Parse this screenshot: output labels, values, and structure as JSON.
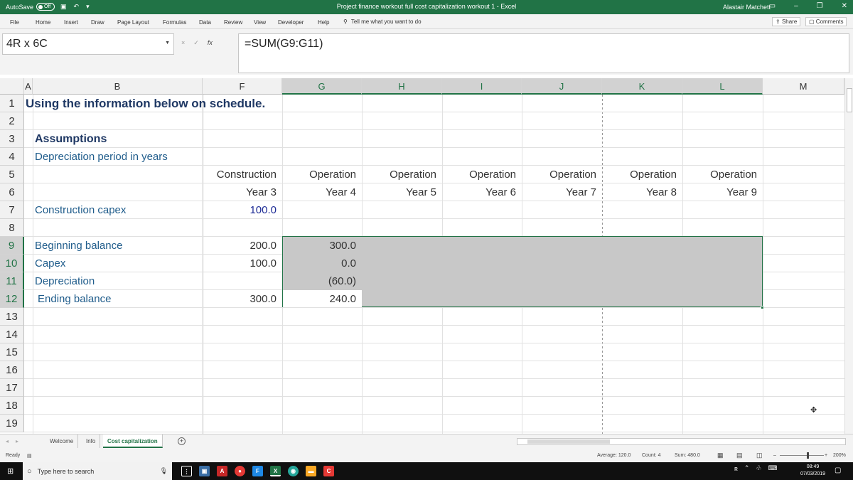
{
  "titlebar": {
    "autosave_label": "AutoSave",
    "autosave_state": "Off",
    "document_title": "Project finance workout full cost capitalization workout 1  -  Excel",
    "user": "Alastair Matchett"
  },
  "menu": {
    "tabs": [
      "File",
      "Home",
      "Insert",
      "Draw",
      "Page Layout",
      "Formulas",
      "Data",
      "Review",
      "View",
      "Developer",
      "Help"
    ],
    "tell_me": "Tell me what you want to do",
    "share": "Share",
    "comments": "Comments"
  },
  "formula_bar": {
    "name_box": "4R x 6C",
    "formula": "=SUM(G9:G11)",
    "cancel_glyph": "×",
    "enter_glyph": "✓",
    "fx_glyph": "fx"
  },
  "columns": [
    "A",
    "B",
    "F",
    "G",
    "H",
    "I",
    "J",
    "K",
    "L",
    "M"
  ],
  "rows": [
    "1",
    "2",
    "3",
    "4",
    "5",
    "6",
    "7",
    "8",
    "9",
    "10",
    "11",
    "12",
    "13",
    "14",
    "15",
    "16",
    "17",
    "18",
    "19"
  ],
  "cells": {
    "title": "Using the information below on schedule.",
    "assumptions": "Assumptions",
    "dep_period": "Depreciation period in years",
    "construction_capex": "Construction capex",
    "capex_value": "100.0",
    "beginning_balance": "Beginning balance",
    "capex": "Capex",
    "depreciation": "Depreciation",
    "ending_balance": "Ending balance",
    "f9": "200.0",
    "f10": "100.0",
    "f12": "300.0",
    "g9": "300.0",
    "g10": "0.0",
    "g11": "(60.0)",
    "g12": "240.0",
    "headers": [
      {
        "phase": "Construction",
        "year": "Year 3"
      },
      {
        "phase": "Operation",
        "year": "Year 4"
      },
      {
        "phase": "Operation",
        "year": "Year 5"
      },
      {
        "phase": "Operation",
        "year": "Year 6"
      },
      {
        "phase": "Operation",
        "year": "Year 7"
      },
      {
        "phase": "Operation",
        "year": "Year 8"
      },
      {
        "phase": "Operation",
        "year": "Year 9"
      }
    ]
  },
  "sheets": {
    "tabs": [
      "Welcome",
      "Info",
      "Cost capitalization"
    ],
    "active": "Cost capitalization"
  },
  "status": {
    "ready": "Ready",
    "average": "Average: 120.0",
    "count": "Count: 4",
    "sum": "Sum: 480.0",
    "zoom": "200%"
  },
  "taskbar": {
    "search_placeholder": "Type here to search",
    "time": "08:49",
    "date": "07/03/2019"
  },
  "colors": {
    "excel_green": "#217346",
    "label_blue": "#1f5c8b",
    "input_blue": "#1f2d96"
  }
}
